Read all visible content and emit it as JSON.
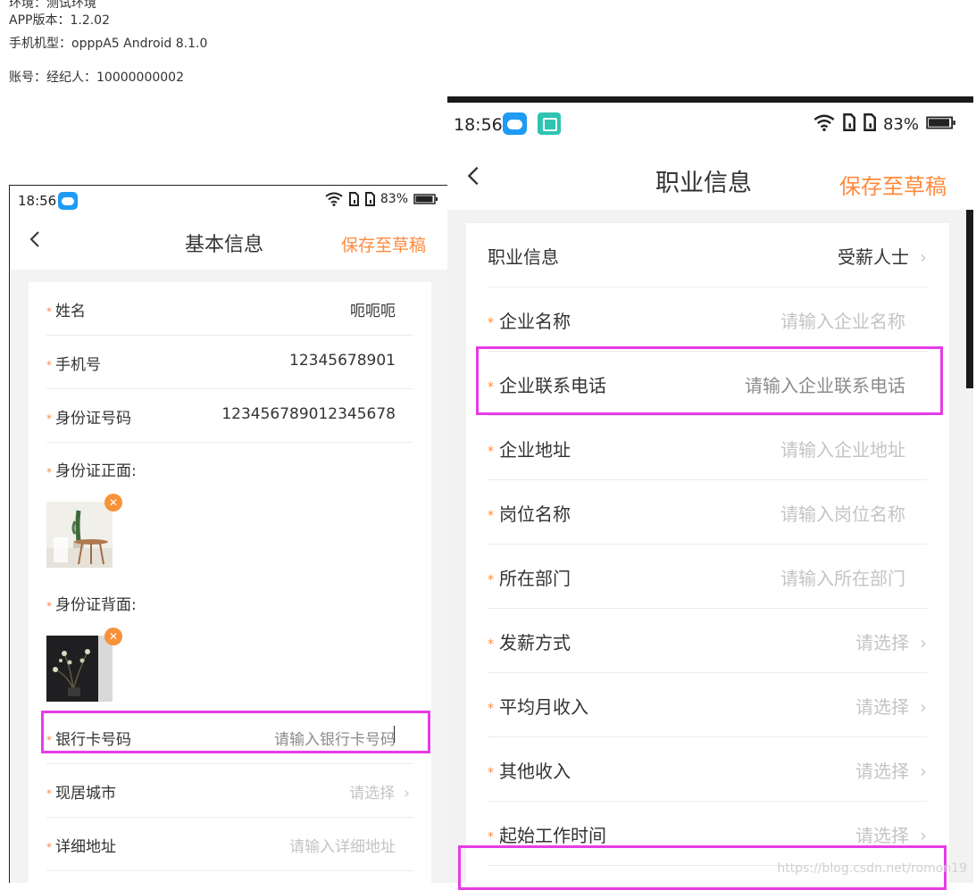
{
  "report": {
    "line0": "环境：测试环境",
    "line1": "APP版本：1.2.02",
    "line2": "手机机型：opppA5 Android 8.1.0",
    "line3": "账号：经纪人：10000000002"
  },
  "left_phone": {
    "status": {
      "time": "18:56",
      "battery": "83%"
    },
    "nav": {
      "back_icon": "chevron-left-icon",
      "title": "基本信息",
      "save_label": "保存至草稿"
    },
    "rows": [
      {
        "label": "姓名",
        "value": "呃呃呃"
      },
      {
        "label": "手机号",
        "value": "12345678901"
      },
      {
        "label": "身份证号码",
        "value": "123456789012345678"
      }
    ],
    "id_front_label": "身份证正面:",
    "id_back_label": "身份证背面:",
    "rows2": [
      {
        "label": "银行卡号码",
        "value": "请输入银行卡号码"
      },
      {
        "label": "现居城市",
        "value": "请选择"
      },
      {
        "label": "详细地址",
        "value": "请输入详细地址"
      }
    ],
    "required_mark": "*",
    "chevron": "›"
  },
  "right_phone": {
    "status": {
      "time": "18:56",
      "battery": "83%"
    },
    "nav": {
      "back_icon": "chevron-left-icon",
      "title": "职业信息",
      "save_label": "保存至草稿"
    },
    "rows": [
      {
        "label": "职业信息",
        "value": "受薪人士"
      },
      {
        "label": "企业名称",
        "value": "请输入企业名称"
      },
      {
        "label": "企业联系电话",
        "value": "请输入企业联系电话"
      },
      {
        "label": "企业地址",
        "value": "请输入企业地址"
      },
      {
        "label": "岗位名称",
        "value": "请输入岗位名称"
      },
      {
        "label": "所在部门",
        "value": "请输入所在部门"
      },
      {
        "label": "发薪方式",
        "value": "请选择"
      },
      {
        "label": "平均月收入",
        "value": "请选择"
      },
      {
        "label": "其他收入",
        "value": "请选择"
      },
      {
        "label": "起始工作时间",
        "value": "请选择"
      }
    ],
    "required_mark": "*",
    "chevron": "›"
  },
  "colors": {
    "accent": "#ff8a3d",
    "highlight": "#e63ce6",
    "placeholder": "#c4c4c4"
  },
  "watermark": "https://blog.csdn.net/romon19"
}
